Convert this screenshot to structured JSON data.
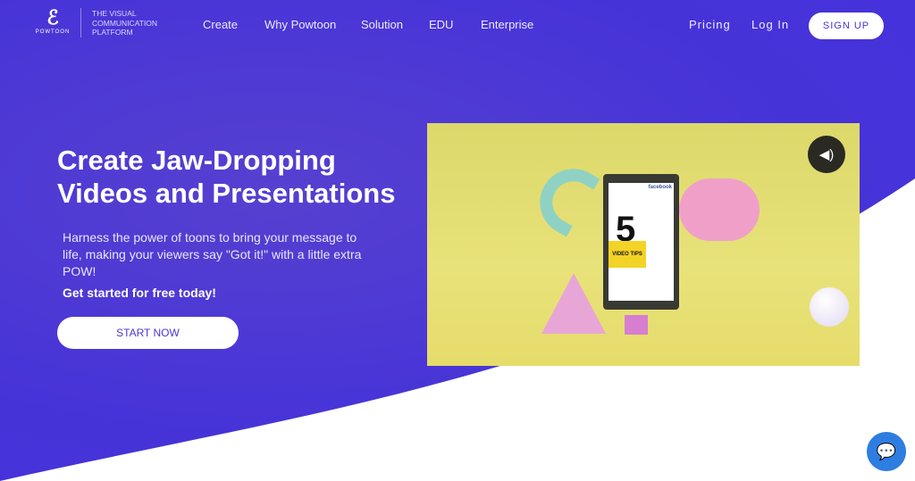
{
  "brand": {
    "logo": "POWTOON",
    "tagline": [
      "THE VISUAL",
      "COMMUNICATION",
      "PLATFORM"
    ]
  },
  "nav": {
    "items": [
      "Create",
      "Why Powtoon",
      "Solution",
      "EDU",
      "Enterprise"
    ],
    "pricing": "Pricing",
    "login": "Log In",
    "signup": "SIGN UP"
  },
  "hero": {
    "title_line1": "Create Jaw-Dropping",
    "title_line2": "Videos and Presentations",
    "description": "Harness the power of toons to bring your message to life, making your viewers say \"Got it!\" with a little extra POW!",
    "cta_text": "Get started for free today!",
    "start_button": "START NOW"
  },
  "video": {
    "fb_label": "facebook",
    "number": "5",
    "tips_label": "VIDEO TIPS",
    "sound_icon": "speaker-icon"
  },
  "colors": {
    "primary": "#4a35d6",
    "white": "#ffffff",
    "chat": "#2e7de1"
  }
}
